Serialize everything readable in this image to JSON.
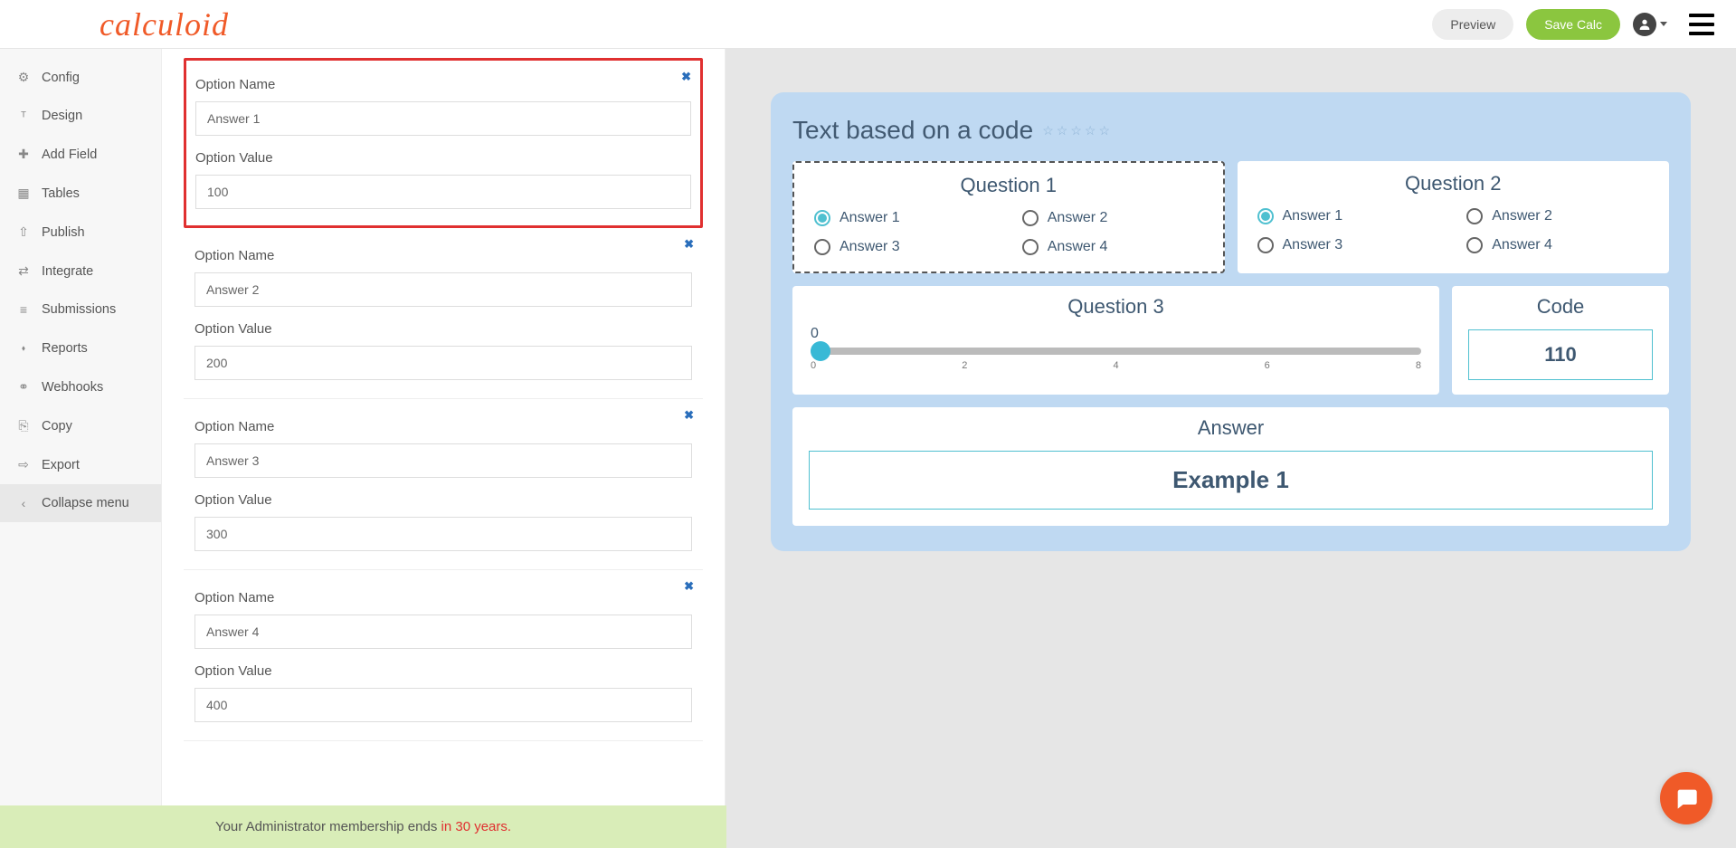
{
  "header": {
    "logo": "calculoid",
    "preview": "Preview",
    "save": "Save Calc"
  },
  "sidebar": {
    "items": [
      {
        "label": "Config",
        "icon": "⚙"
      },
      {
        "label": "Design",
        "icon": "ᵀ"
      },
      {
        "label": "Add Field",
        "icon": "✚"
      },
      {
        "label": "Tables",
        "icon": "▦"
      },
      {
        "label": "Publish",
        "icon": "⇧"
      },
      {
        "label": "Integrate",
        "icon": "⇄"
      },
      {
        "label": "Submissions",
        "icon": "≡"
      },
      {
        "label": "Reports",
        "icon": "⬪"
      },
      {
        "label": "Webhooks",
        "icon": "⚭"
      },
      {
        "label": "Copy",
        "icon": "⎘"
      },
      {
        "label": "Export",
        "icon": "⇨"
      }
    ],
    "collapse": "Collapse menu"
  },
  "editor": {
    "options": [
      {
        "name_label": "Option Name",
        "name_value": "Answer 1",
        "value_label": "Option Value",
        "value_value": "100",
        "highlighted": true
      },
      {
        "name_label": "Option Name",
        "name_value": "Answer 2",
        "value_label": "Option Value",
        "value_value": "200",
        "highlighted": false
      },
      {
        "name_label": "Option Name",
        "name_value": "Answer 3",
        "value_label": "Option Value",
        "value_value": "300",
        "highlighted": false
      },
      {
        "name_label": "Option Name",
        "name_value": "Answer 4",
        "value_label": "Option Value",
        "value_value": "400",
        "highlighted": false
      }
    ]
  },
  "preview": {
    "title": "Text based on a code",
    "q1": {
      "title": "Question 1",
      "opts": [
        "Answer 1",
        "Answer 2",
        "Answer 3",
        "Answer 4"
      ],
      "selected": 0
    },
    "q2": {
      "title": "Question 2",
      "opts": [
        "Answer 1",
        "Answer 2",
        "Answer 3",
        "Answer 4"
      ],
      "selected": 0
    },
    "q3": {
      "title": "Question 3",
      "value": "0",
      "ticks": [
        "0",
        "2",
        "4",
        "6",
        "8"
      ]
    },
    "code": {
      "title": "Code",
      "value": "110"
    },
    "answer": {
      "title": "Answer",
      "value": "Example 1"
    }
  },
  "footer": {
    "prefix": "Your Administrator membership ends ",
    "suffix": "in 30 years."
  }
}
